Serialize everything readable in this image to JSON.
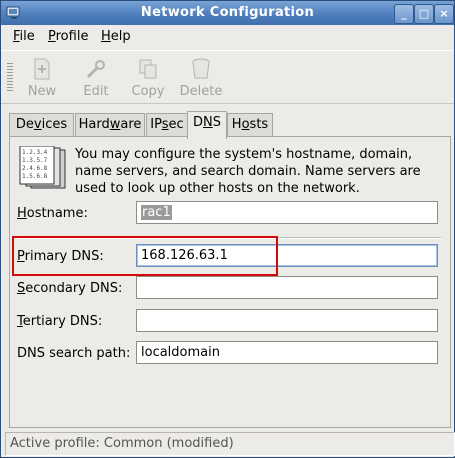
{
  "window": {
    "title": "Network Configuration",
    "buttons": {
      "minimize": "_",
      "maximize": "□",
      "close": "×"
    }
  },
  "menubar": {
    "items": [
      {
        "label": "File",
        "mnemonic": "F",
        "rest": "ile"
      },
      {
        "label": "Profile",
        "mnemonic": "P",
        "rest": "rofile"
      },
      {
        "label": "Help",
        "mnemonic": "H",
        "rest": "elp"
      }
    ]
  },
  "toolbar": {
    "items": [
      {
        "label": "New",
        "icon": "new-icon"
      },
      {
        "label": "Edit",
        "icon": "edit-icon"
      },
      {
        "label": "Copy",
        "icon": "copy-icon"
      },
      {
        "label": "Delete",
        "icon": "delete-icon"
      }
    ]
  },
  "tabs": [
    {
      "label": "Devices",
      "pre": "De",
      "mnemonic": "v",
      "post": "ices"
    },
    {
      "label": "Hardware",
      "pre": "Hard",
      "mnemonic": "w",
      "post": "are"
    },
    {
      "label": "IPsec",
      "pre": "IP",
      "mnemonic": "s",
      "post": "ec"
    },
    {
      "label": "DNS",
      "pre": "D",
      "mnemonic": "N",
      "post": "S",
      "active": true
    },
    {
      "label": "Hosts",
      "pre": "H",
      "mnemonic": "o",
      "post": "sts"
    }
  ],
  "dns": {
    "intro": "You may configure the system's hostname, domain, name servers, and search domain. Name servers are used to look up other hosts on the network.",
    "hostname": {
      "label_pre": "",
      "label_mnemonic": "H",
      "label_post": "ostname:",
      "value": "rac1"
    },
    "primary": {
      "label_pre": "",
      "label_mnemonic": "P",
      "label_post": "rimary DNS:",
      "value": "168.126.63.1"
    },
    "secondary": {
      "label_pre": "",
      "label_mnemonic": "S",
      "label_post": "econdary DNS:",
      "value": ""
    },
    "tertiary": {
      "label_pre": "",
      "label_mnemonic": "T",
      "label_post": "ertiary DNS:",
      "value": ""
    },
    "search": {
      "label": "DNS search path:",
      "value": "localdomain"
    }
  },
  "status": {
    "text": "Active profile: Common (modified)"
  },
  "colors": {
    "titlebar": "#4f7fbd",
    "highlight": "#d10a0a",
    "window_bg": "#ecebe7"
  }
}
